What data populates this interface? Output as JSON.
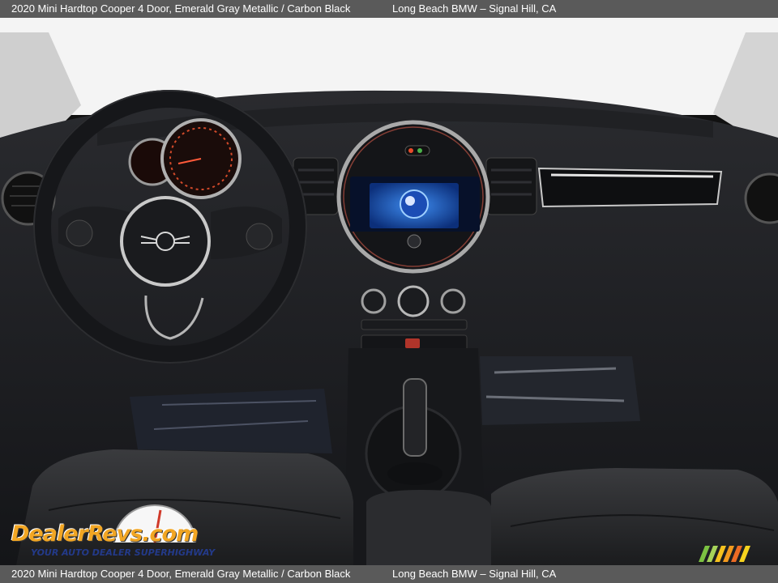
{
  "caption": {
    "title": "2020 Mini Hardtop Cooper 4 Door,  Emerald Gray Metallic / Carbon Black",
    "dealer": "Long Beach BMW – Signal Hill, CA"
  },
  "watermark": {
    "brand": "DealerRevs.com",
    "tagline": "YOUR AUTO DEALER SUPERHIGHWAY"
  },
  "photo": {
    "subject": "car-interior-dashboard",
    "colors": {
      "caption_bar": "#5a5a5a",
      "interior": "#1c1d20",
      "screen": "#1f6fd6",
      "watermark_orange": "#f2a623",
      "watermark_blue": "#233a8a"
    }
  }
}
